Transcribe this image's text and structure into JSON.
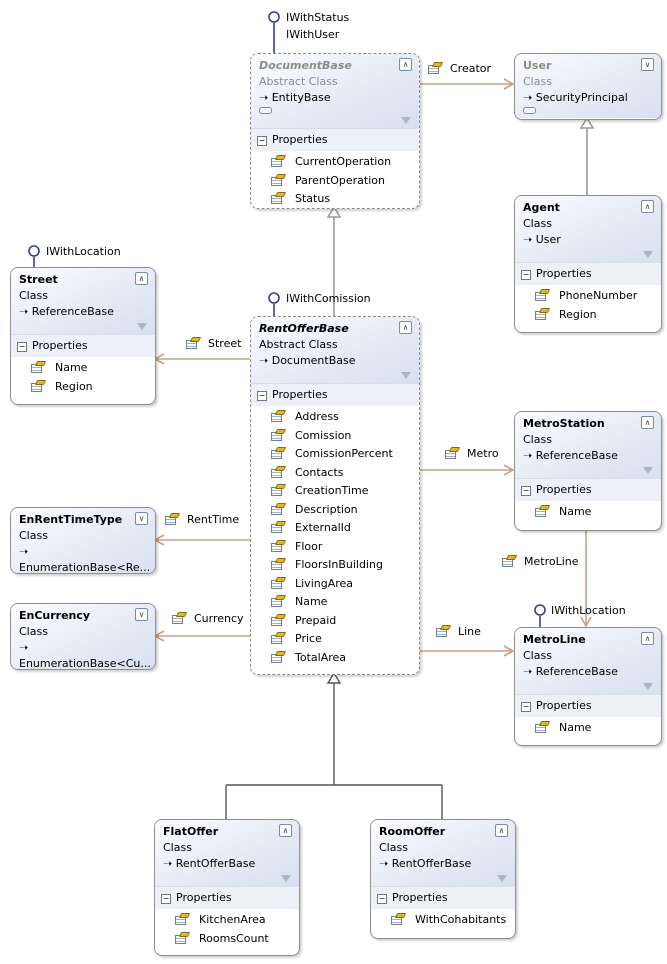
{
  "classes": [
    {
      "id": "document-base",
      "name": "DocumentBase",
      "kind": "Abstract Class",
      "base": "EntityBase",
      "abstract": true,
      "grey": true,
      "collapsed": false,
      "lollipop_row": true,
      "properties": [
        "CurrentOperation",
        "ParentOperation",
        "Status"
      ]
    },
    {
      "id": "user",
      "name": "User",
      "kind": "Class",
      "base": "SecurityPrincipal",
      "abstract": false,
      "grey": true,
      "collapsed": true,
      "lollipop_row": true,
      "properties": []
    },
    {
      "id": "agent",
      "name": "Agent",
      "kind": "Class",
      "base": "User",
      "abstract": false,
      "grey": false,
      "collapsed": false,
      "properties": [
        "PhoneNumber",
        "Region"
      ]
    },
    {
      "id": "street",
      "name": "Street",
      "kind": "Class",
      "base": "ReferenceBase",
      "abstract": false,
      "grey": false,
      "collapsed": false,
      "properties": [
        "Name",
        "Region"
      ]
    },
    {
      "id": "rent-offer-base",
      "name": "RentOfferBase",
      "kind": "Abstract Class",
      "base": "DocumentBase",
      "abstract": true,
      "grey": false,
      "collapsed": false,
      "properties": [
        "Address",
        "Comission",
        "ComissionPercent",
        "Contacts",
        "CreationTime",
        "Description",
        "ExternalId",
        "Floor",
        "FloorsInBuilding",
        "LivingArea",
        "Name",
        "Prepaid",
        "Price",
        "TotalArea"
      ]
    },
    {
      "id": "metro-station",
      "name": "MetroStation",
      "kind": "Class",
      "base": "ReferenceBase",
      "abstract": false,
      "grey": false,
      "collapsed": false,
      "properties": [
        "Name"
      ]
    },
    {
      "id": "en-rent-time-type",
      "name": "EnRentTimeType",
      "kind": "Class",
      "base": "EnumerationBase<Re...",
      "abstract": false,
      "grey": false,
      "collapsed": true,
      "properties": []
    },
    {
      "id": "en-currency",
      "name": "EnCurrency",
      "kind": "Class",
      "base": "EnumerationBase<Cu...",
      "abstract": false,
      "grey": false,
      "collapsed": true,
      "properties": []
    },
    {
      "id": "metro-line",
      "name": "MetroLine",
      "kind": "Class",
      "base": "ReferenceBase",
      "abstract": false,
      "grey": false,
      "collapsed": false,
      "properties": [
        "Name"
      ]
    },
    {
      "id": "flat-offer",
      "name": "FlatOffer",
      "kind": "Class",
      "base": "RentOfferBase",
      "abstract": false,
      "grey": false,
      "collapsed": false,
      "properties": [
        "KitchenArea",
        "RoomsCount"
      ]
    },
    {
      "id": "room-offer",
      "name": "RoomOffer",
      "kind": "Class",
      "base": "RentOfferBase",
      "abstract": false,
      "grey": false,
      "collapsed": false,
      "properties": [
        "WithCohabitants"
      ]
    }
  ],
  "section_label": "Properties",
  "interfaces": {
    "document_base": [
      "IWithStatus",
      "IWithUser"
    ],
    "rent_offer_base": "IWithComission",
    "street": "IWithLocation",
    "metro_line": "IWithLocation"
  },
  "associations": {
    "creator": "Creator",
    "street": "Street",
    "metro": "Metro",
    "rent_time": "RentTime",
    "currency": "Currency",
    "line": "Line",
    "metro_line": "MetroLine"
  },
  "colors": {
    "association": "#c8a088",
    "inheritance": "#9a9a9a",
    "lollipop": "#3a3aa0"
  }
}
